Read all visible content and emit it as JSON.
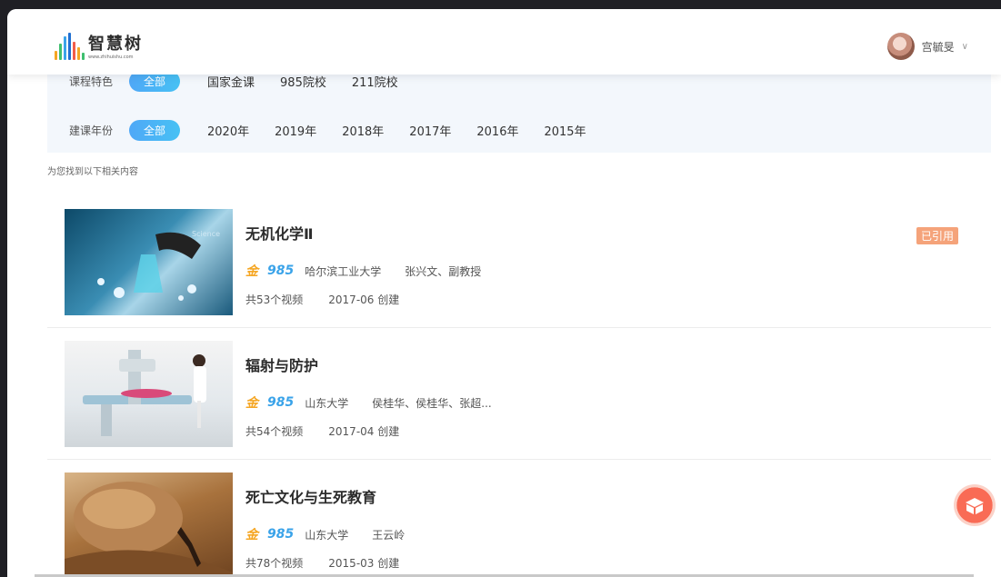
{
  "header": {
    "logo_text": "智慧树",
    "logo_url": "www.zhihuishu.com",
    "username": "宫毓旻"
  },
  "filters": {
    "rows": [
      {
        "label": "课程特色",
        "all": "全部",
        "options": [
          "国家金课",
          "985院校",
          "211院校"
        ]
      },
      {
        "label": "建课年份",
        "all": "全部",
        "options": [
          "2020年",
          "2019年",
          "2018年",
          "2017年",
          "2016年",
          "2015年"
        ]
      }
    ]
  },
  "results_text": "为您找到以下相关内容",
  "courses": [
    {
      "title": "无机化学Ⅱ",
      "jin": "金",
      "tag985": "985",
      "school": "哈尔滨工业大学",
      "teachers": "张兴文、副教授",
      "videos": "共53个视频",
      "created": "2017-06 创建",
      "badge": "已引用"
    },
    {
      "title": "辐射与防护",
      "jin": "金",
      "tag985": "985",
      "school": "山东大学",
      "teachers": "侯桂华、侯桂华、张超...",
      "videos": "共54个视频",
      "created": "2017-04 创建"
    },
    {
      "title": "死亡文化与生死教育",
      "jin": "金",
      "tag985": "985",
      "school": "山东大学",
      "teachers": "王云岭",
      "videos": "共78个视频",
      "created": "2015-03 创建"
    }
  ],
  "colors": {
    "accent": "#4fa8f7",
    "gold": "#f5a623",
    "badge": "#f5a37a"
  },
  "icons": {
    "float_button": "gift-box-icon",
    "chevron": "chevron-down-icon"
  }
}
